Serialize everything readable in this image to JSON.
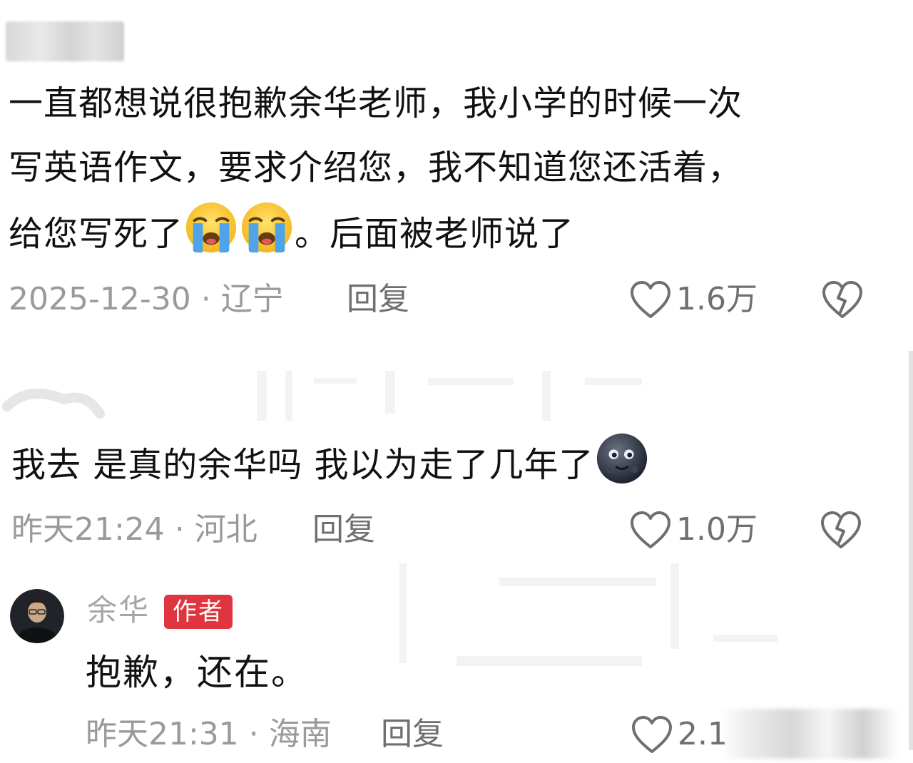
{
  "comments": [
    {
      "text_lines": [
        "一直都想说很抱歉余华老师，我小学的时候一次",
        "写英语作文，要求介绍您，我不知道您还活着，",
        "给您写死了"
      ],
      "text_tail": "。后面被老师说了",
      "emoji": "crying-face",
      "time": "2025-12-30",
      "location": "辽宁",
      "reply_label": "回复",
      "likes": "1.6万"
    },
    {
      "text": "我去 是真的余华吗 我以为走了几年了",
      "emoji": "new-moon-face",
      "time": "昨天21:24",
      "location": "河北",
      "reply_label": "回复",
      "likes": "1.0万"
    }
  ],
  "reply": {
    "author": "余华",
    "badge": "作者",
    "text": "抱歉，还在。",
    "time": "昨天21:31",
    "location": "海南",
    "reply_label": "回复",
    "likes": "2.1"
  },
  "colors": {
    "badge_bg": "#e0343e",
    "meta_text": "#9a9a9a",
    "action_text": "#6f6f6f"
  },
  "icons": {
    "like": "heart-outline-icon",
    "dislike": "broken-heart-icon"
  }
}
